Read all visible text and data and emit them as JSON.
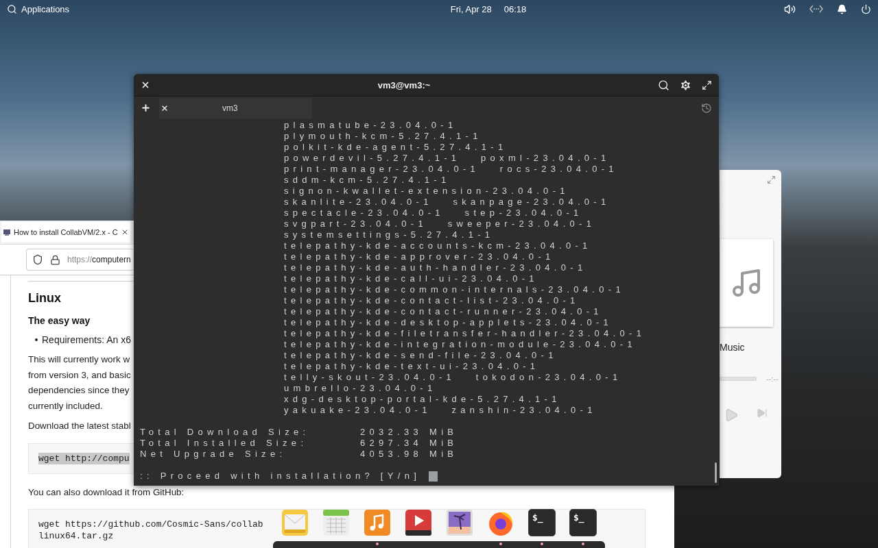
{
  "top_bar": {
    "applications": "Applications",
    "date": "Fri, Apr 28",
    "time": "06:18"
  },
  "browser": {
    "tab_title": "How to install CollabVM/2.x - C",
    "url_scheme": "https://",
    "url_host": "computern",
    "content": [
      {
        "kind": "heading",
        "lines": [
          "Linux"
        ]
      },
      {
        "kind": "subheading",
        "lines": [
          "The easy way"
        ]
      },
      {
        "kind": "bullet",
        "lines": [
          "Requirements: An x6"
        ]
      },
      {
        "kind": "paragraph",
        "lines": [
          "This will currently work w",
          "from version 3, and basic",
          "dependencies since they",
          "currently included."
        ]
      },
      {
        "kind": "paragraph",
        "lines": [
          "Download the latest stabl"
        ]
      },
      {
        "kind": "code",
        "selected": true,
        "lines": [
          "wget http://compu"
        ]
      },
      {
        "kind": "paragraph",
        "lines": [
          "You can also download it from GitHub:"
        ]
      },
      {
        "kind": "code",
        "selected": false,
        "lines": [
          "wget https://github.com/Cosmic-Sans/collab",
          "linux64.tar.gz"
        ]
      }
    ]
  },
  "terminal": {
    "title": "vm3@vm3:~",
    "tabs": [
      {
        "label": "vm3",
        "selected": true
      }
    ],
    "package_lines": [
      "plasmatube-23.04.0-1",
      "plymouth-kcm-5.27.4.1-1",
      "polkit-kde-agent-5.27.4.1-1",
      "powerdevil-5.27.4.1-1   poxml-23.04.0-1",
      "print-manager-23.04.0-1   rocs-23.04.0-1",
      "sddm-kcm-5.27.4.1-1",
      "signon-kwallet-extension-23.04.0-1",
      "skanlite-23.04.0-1   skanpage-23.04.0-1",
      "spectacle-23.04.0-1   step-23.04.0-1",
      "svgpart-23.04.0-1   sweeper-23.04.0-1",
      "systemsettings-5.27.4.1-1",
      "telepathy-kde-accounts-kcm-23.04.0-1",
      "telepathy-kde-approver-23.04.0-1",
      "telepathy-kde-auth-handler-23.04.0-1",
      "telepathy-kde-call-ui-23.04.0-1",
      "telepathy-kde-common-internals-23.04.0-1",
      "telepathy-kde-contact-list-23.04.0-1",
      "telepathy-kde-contact-runner-23.04.0-1",
      "telepathy-kde-desktop-applets-23.04.0-1",
      "telepathy-kde-filetransfer-handler-23.04.0-1",
      "telepathy-kde-integration-module-23.04.0-1",
      "telepathy-kde-send-file-23.04.0-1",
      "telepathy-kde-text-ui-23.04.0-1",
      "telly-skout-23.04.0-1   tokodon-23.04.0-1",
      "umbrello-23.04.0-1",
      "xdg-desktop-portal-kde-5.27.4.1-1",
      "yakuake-23.04.0-1   zanshin-23.04.0-1"
    ],
    "summary": [
      {
        "label": "Total Download Size:",
        "value": "2032.33 MiB"
      },
      {
        "label": "Total Installed Size:",
        "value": "6297.34 MiB"
      },
      {
        "label": "Net Upgrade Size:",
        "value": "4053.98 MiB"
      }
    ],
    "prompt": ":: Proceed with installation? [Y/n]"
  },
  "music": {
    "title": "Music",
    "time": "--:--",
    "level": 0
  },
  "dock": [
    {
      "kind": "mail",
      "running": false
    },
    {
      "kind": "calendar",
      "running": false
    },
    {
      "kind": "music",
      "running": true
    },
    {
      "kind": "video",
      "running": false
    },
    {
      "kind": "photos",
      "running": false
    },
    {
      "kind": "browser",
      "running": true
    },
    {
      "kind": "terminal",
      "label": "$_",
      "running": true
    },
    {
      "kind": "terminal",
      "label": "$_",
      "running": true
    }
  ]
}
